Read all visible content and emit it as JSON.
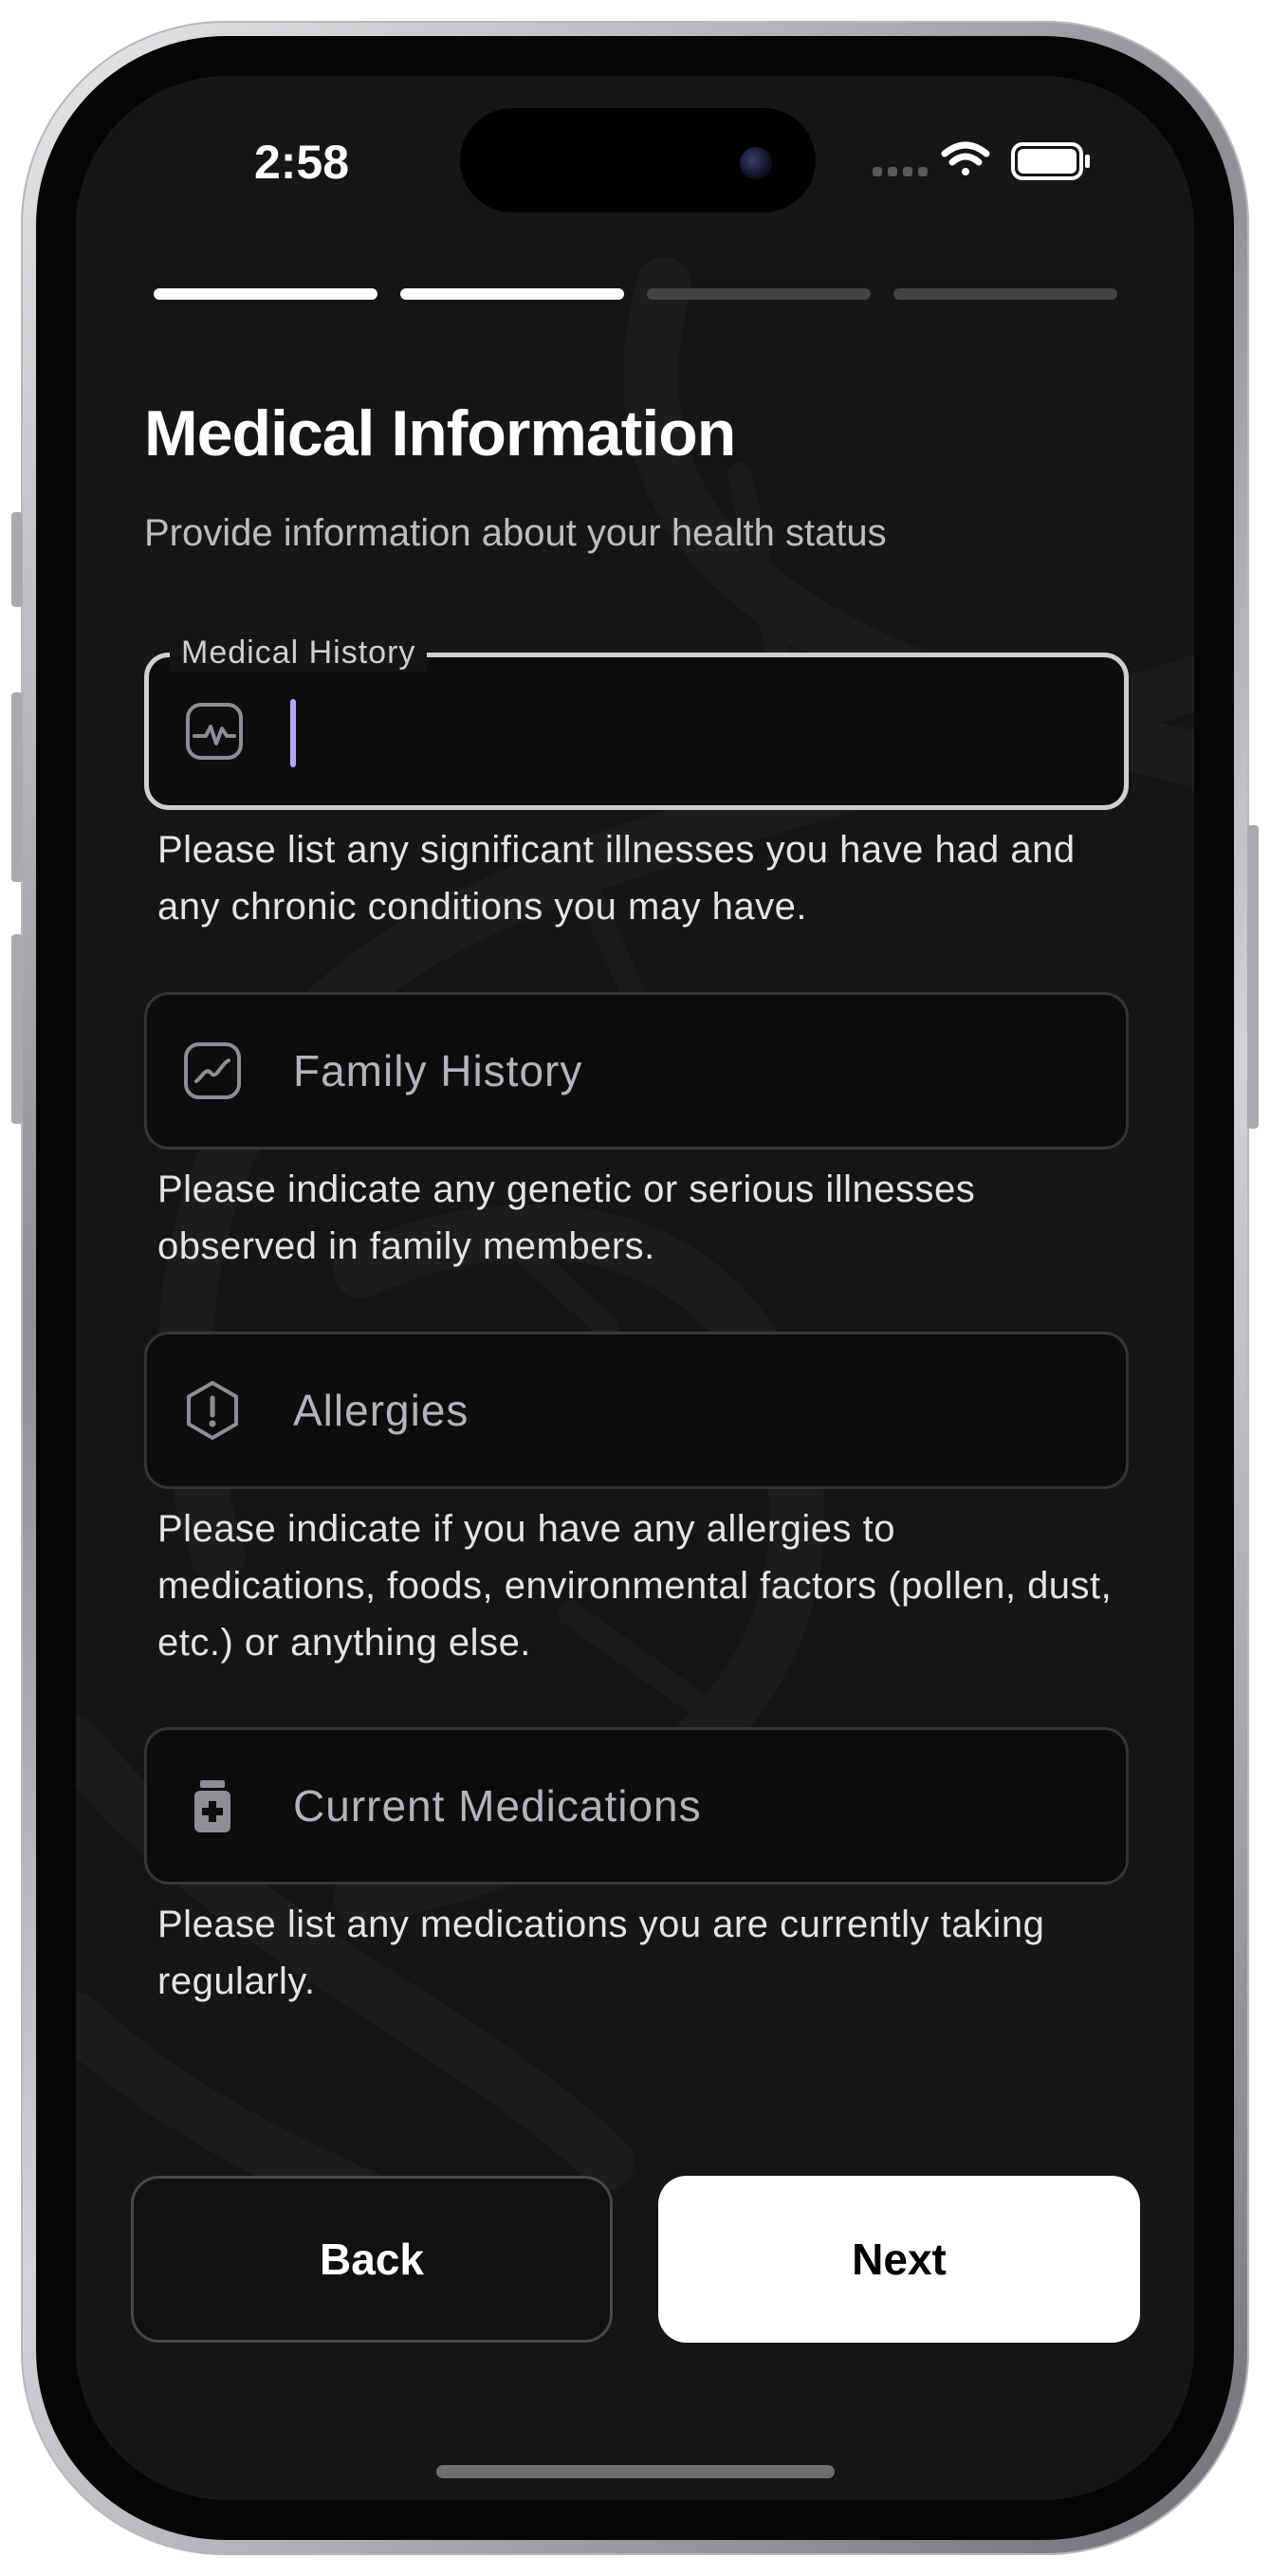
{
  "status_bar": {
    "time": "2:58",
    "icons": [
      "signal-dots-icon",
      "wifi-icon",
      "battery-icon"
    ]
  },
  "progress": {
    "total_steps": 4,
    "completed_steps": 2,
    "active_color": "#ffffff",
    "inactive_color": "#444444"
  },
  "header": {
    "title": "Medical Information",
    "subtitle": "Provide information about your health status"
  },
  "fields": [
    {
      "key": "medical_history",
      "label": "Medical History",
      "value": "",
      "icon": "heart-monitor-icon",
      "focused": true,
      "helper": "Please list any significant illnesses you have had and any chronic conditions you may have."
    },
    {
      "key": "family_history",
      "placeholder": "Family History",
      "icon": "trend-chart-icon",
      "helper": "Please indicate any genetic or serious illnesses observed in family members."
    },
    {
      "key": "allergies",
      "placeholder": "Allergies",
      "icon": "alert-hexagon-icon",
      "helper": "Please indicate if you have any allergies to medications, foods, environmental factors (pollen, dust, etc.) or anything else."
    },
    {
      "key": "current_medications",
      "placeholder": "Current Medications",
      "icon": "pill-bottle-icon",
      "helper": "Please list any medications you are currently taking regularly."
    }
  ],
  "actions": {
    "back_label": "Back",
    "next_label": "Next"
  },
  "colors": {
    "screen_bg": "#161616",
    "field_bg": "#0d0d0f",
    "caret": "#b5a7f5"
  }
}
